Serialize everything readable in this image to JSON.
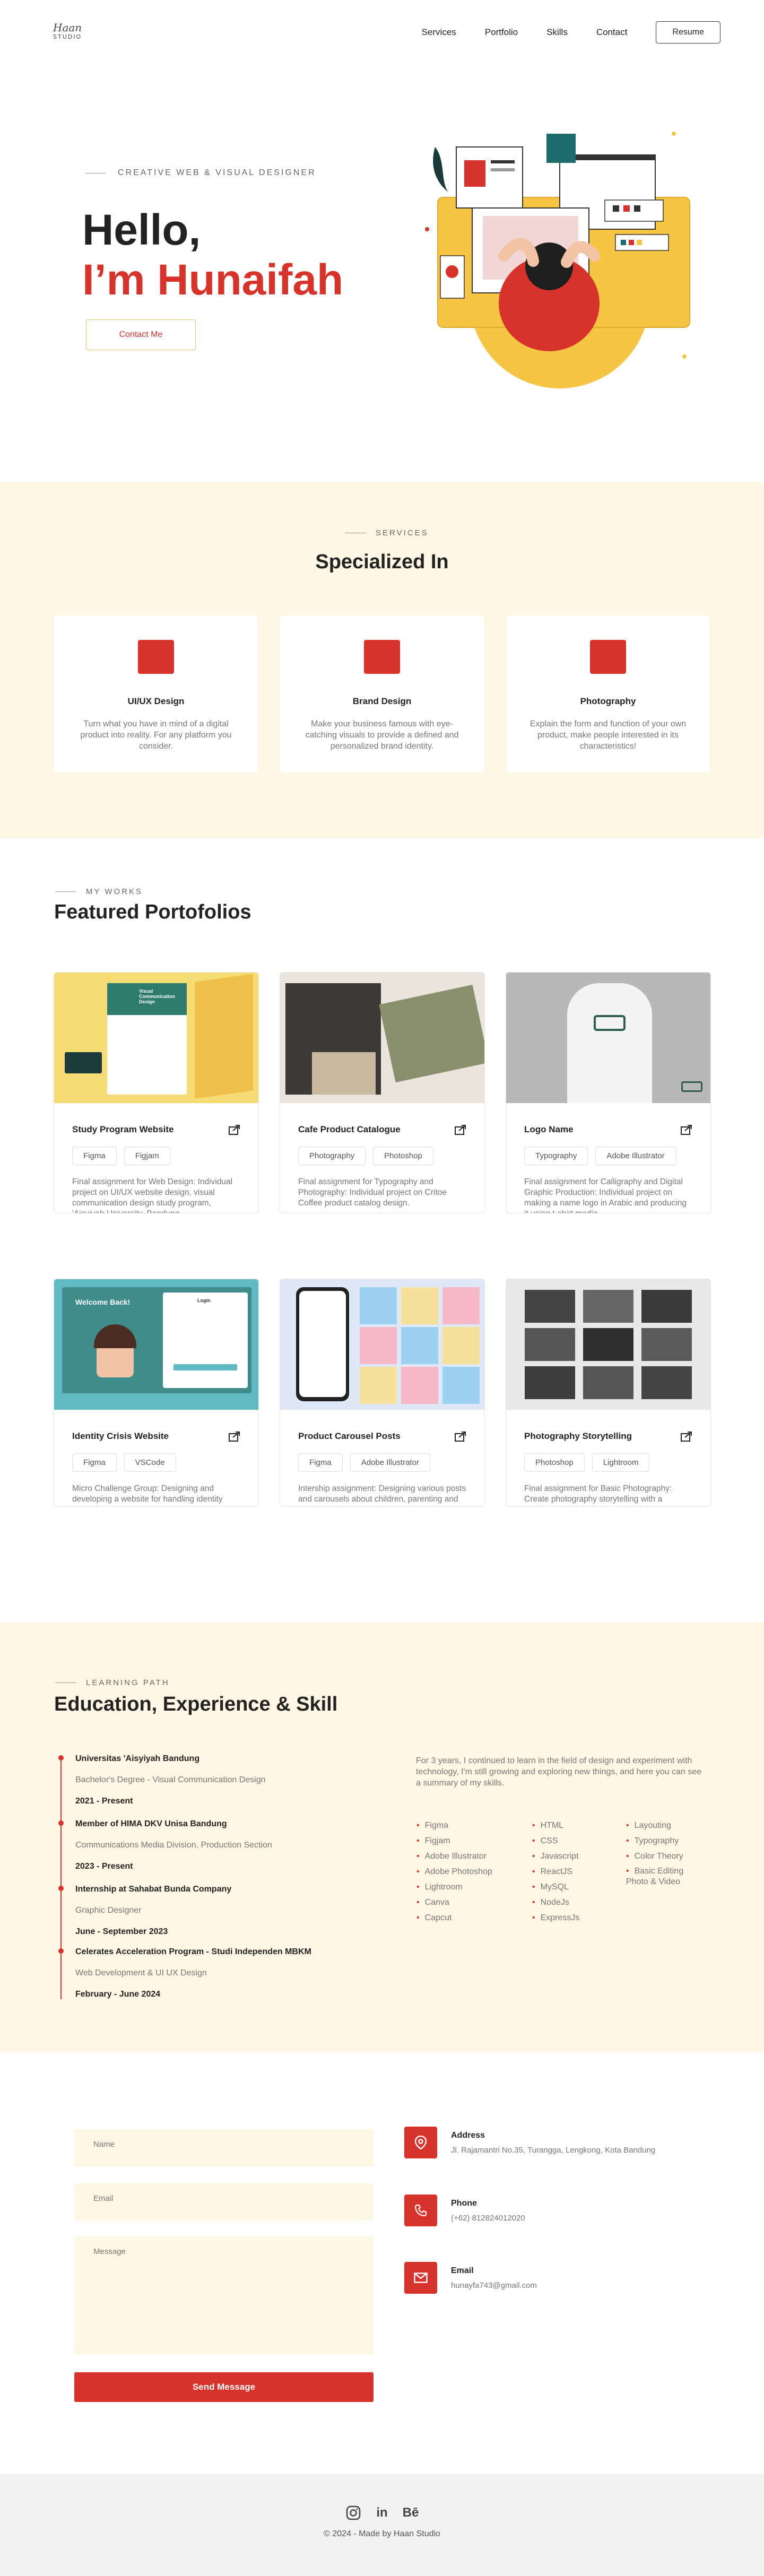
{
  "nav": {
    "logo_script": "Haan",
    "logo_sub": "STUDIO",
    "links": [
      "Services",
      "Portfolio",
      "Skills",
      "Contact"
    ],
    "resume": "Resume"
  },
  "hero": {
    "subtitle": "CREATIVE WEB & VISUAL DESIGNER",
    "line1": "Hello,",
    "line2": "I’m Hunaifah",
    "cta": "Contact Me"
  },
  "services": {
    "subtitle": "SERVICES",
    "title": "Specialized In",
    "items": [
      {
        "title": "UI/UX Design",
        "desc": "Turn what you have in mind of a digital product into reality. For any platform you consider."
      },
      {
        "title": "Brand Design",
        "desc": "Make your business famous with eye-catching visuals to provide a defined and personalized brand identity."
      },
      {
        "title": "Photography",
        "desc": "Explain the form and function of your own product, make people interested in its characteristics!"
      }
    ]
  },
  "portfolio": {
    "subtitle": "MY WORKS",
    "title": "Featured Portofolios",
    "items": [
      {
        "title": "Study Program Website",
        "tags": [
          "Figma",
          "Figjam"
        ],
        "desc": "Final assignment for Web Design: Individual project on UI/UX website design, visual communication design study program, 'Aisyiyah University, Bandung."
      },
      {
        "title": "Cafe Product Catalogue",
        "tags": [
          "Photography",
          "Photoshop"
        ],
        "desc": "Final assignment for Typography and Photography: Individual project on Critoe Coffee product catalog design."
      },
      {
        "title": "Logo Name",
        "tags": [
          "Typography",
          "Adobe Illustrator"
        ],
        "desc": "Final assignment for Calligraphy and Digital Graphic Production: Individual project on making a name logo in Arabic and producing it using t-shirt media."
      },
      {
        "title": "Identity Crisis Website",
        "tags": [
          "Figma",
          "VSCode"
        ],
        "desc": "Micro Challenge Group: Designing and developing a website for handling identity crises in young people."
      },
      {
        "title": "Product Carousel Posts",
        "tags": [
          "Figma",
          "Adobe Illustrator"
        ],
        "desc": "Intership assignment: Designing various posts and carousels about children, parenting and products Sahabat Bunda."
      },
      {
        "title": "Photography Storytelling",
        "tags": [
          "Photoshop",
          "Lightroom"
        ],
        "desc": "Final assignment for Basic Photography: Create photography storytelling with a traditional market theme with a focus on human interest photography."
      }
    ],
    "img1_text": "Visual Communication Design",
    "img4_text": "Welcome Back!",
    "img4_login": "Login"
  },
  "education": {
    "subtitle": "LEARNING PATH",
    "title": "Education, Experience & Skill",
    "timeline": [
      {
        "title": "Universitas 'Aisyiyah Bandung",
        "sub": "Bachelor's Degree - Visual Communication Design",
        "date": "2021 - Present"
      },
      {
        "title": "Member of HIMA DKV Unisa Bandung",
        "sub": "Communications Media Division, Production Section",
        "date": "2023 - Present"
      },
      {
        "title": "Internship at Sahabat Bunda Company",
        "sub": "Graphic Designer",
        "date": "June - September 2023"
      },
      {
        "title": "Celerates Acceleration Program - Studi Independen MBKM",
        "sub": "Web Development & UI UX Design",
        "date": "February - June 2024"
      }
    ],
    "intro": "For 3 years, I continued to learn in the field of design and experiment with technology, I'm still growing and exploring new things, and here you can see a summary of my skills.",
    "skills_col1": [
      "Figma",
      "Figjam",
      "Adobe Illustrator",
      "Adobe Photoshop",
      "Lightroom",
      "Canva",
      "Capcut"
    ],
    "skills_col2": [
      "HTML",
      "CSS",
      "Javascript",
      "ReactJS",
      "MySQL",
      "NodeJs",
      "ExpressJs"
    ],
    "skills_col3": [
      "Layouting",
      "Typography",
      "Color Theory",
      "Basic Editing Photo & Video"
    ]
  },
  "contact": {
    "name_placeholder": "Name",
    "email_placeholder": "Email",
    "message_placeholder": "Message",
    "send": "Send Message",
    "address_label": "Address",
    "address_val": "Jl. Rajamantri No.35, Turangga, Lengkong, Kota Bandung",
    "phone_label": "Phone",
    "phone_val": "(+62) 812824012020",
    "email_label": "Email",
    "email_val": "hunayfa743@gmail.com"
  },
  "footer": {
    "social_linkedin": "in",
    "social_behance": "Bē",
    "copyright": "© 2024 - Made by Haan Studio"
  },
  "colors": {
    "accent": "#d8332b",
    "cream": "#fff6e3",
    "yellow": "#f6c544"
  }
}
